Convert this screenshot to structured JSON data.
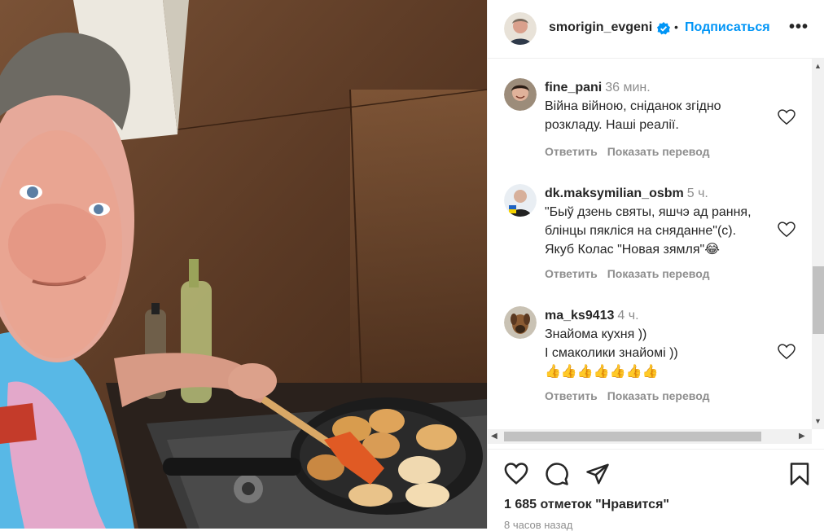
{
  "post": {
    "username": "smorigin_evgeni",
    "dot": "•",
    "follow_label": "Подписаться",
    "more_label": "•••"
  },
  "comments": [
    {
      "username": "fine_pani",
      "time": "36 мин.",
      "text": "Війна війною, сніданок згідно розкладу. Наші реалії.",
      "reply_label": "Ответить",
      "translate_label": "Показать перевод"
    },
    {
      "username": "dk.maksymilian_osbm",
      "time": "5 ч.",
      "text": "\"Быў дзень святы, яшчэ ад рання, блінцы пякліся на сняданне\"(с). Якуб Колас \"Новая зямля\"😂",
      "reply_label": "Ответить",
      "translate_label": "Показать перевод"
    },
    {
      "username": "ma_ks9413",
      "time": "4 ч.",
      "line1": "Знайома кухня ))",
      "line2": "І смаколики знайомі ))",
      "line3": "👍👍👍👍👍👍👍",
      "reply_label": "Ответить",
      "translate_label": "Показать перевод"
    }
  ],
  "footer": {
    "likes_text": "1 685 отметок \"Нравится\"",
    "time_ago": "8 часов назад"
  },
  "icons": {
    "verified": "verified-badge-icon",
    "like": "heart-icon",
    "comment": "comment-icon",
    "share": "share-icon",
    "save": "bookmark-icon"
  },
  "colors": {
    "accent": "#0095f6",
    "text": "#262626",
    "secondary": "#8e8e8e"
  }
}
